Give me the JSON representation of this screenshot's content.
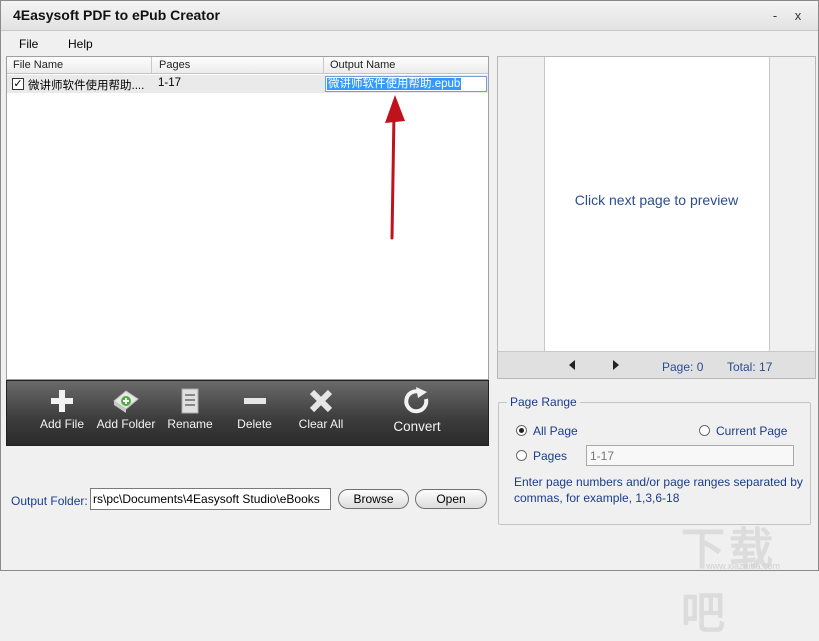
{
  "window": {
    "title": "4Easysoft PDF to ePub Creator",
    "minimize_glyph": "-",
    "close_glyph": "x"
  },
  "menu": [
    {
      "label": "File"
    },
    {
      "label": "Help"
    }
  ],
  "filelist": {
    "columns": [
      "File Name",
      "Pages",
      "Output Name"
    ],
    "rows": [
      {
        "checked": true,
        "file_name": "微讲师软件使用帮助....",
        "pages": "1-17",
        "output_name": "微讲师软件使用帮助.epub"
      }
    ]
  },
  "toolbar": {
    "add_file": "Add File",
    "add_folder": "Add Folder",
    "rename": "Rename",
    "delete": "Delete",
    "clear_all": "Clear All",
    "convert": "Convert"
  },
  "output": {
    "label": "Output Folder:",
    "path": "rs\\pc\\Documents\\4Easysoft Studio\\eBooks",
    "browse": "Browse",
    "open": "Open"
  },
  "preview": {
    "message": "Click next page to preview",
    "page_label": "Page: 0",
    "total_label": "Total: 17"
  },
  "page_range": {
    "legend": "Page Range",
    "all_page": "All Page",
    "current_page": "Current Page",
    "pages": "Pages",
    "pages_value": "1-17",
    "hint": "Enter page numbers and/or page ranges separated by commas, for example, 1,3,6-18",
    "selected": "all_page"
  },
  "colors": {
    "accent_text": "#1a3c8c",
    "selection": "#3399ff",
    "annotation_arrow": "#c0121c"
  }
}
